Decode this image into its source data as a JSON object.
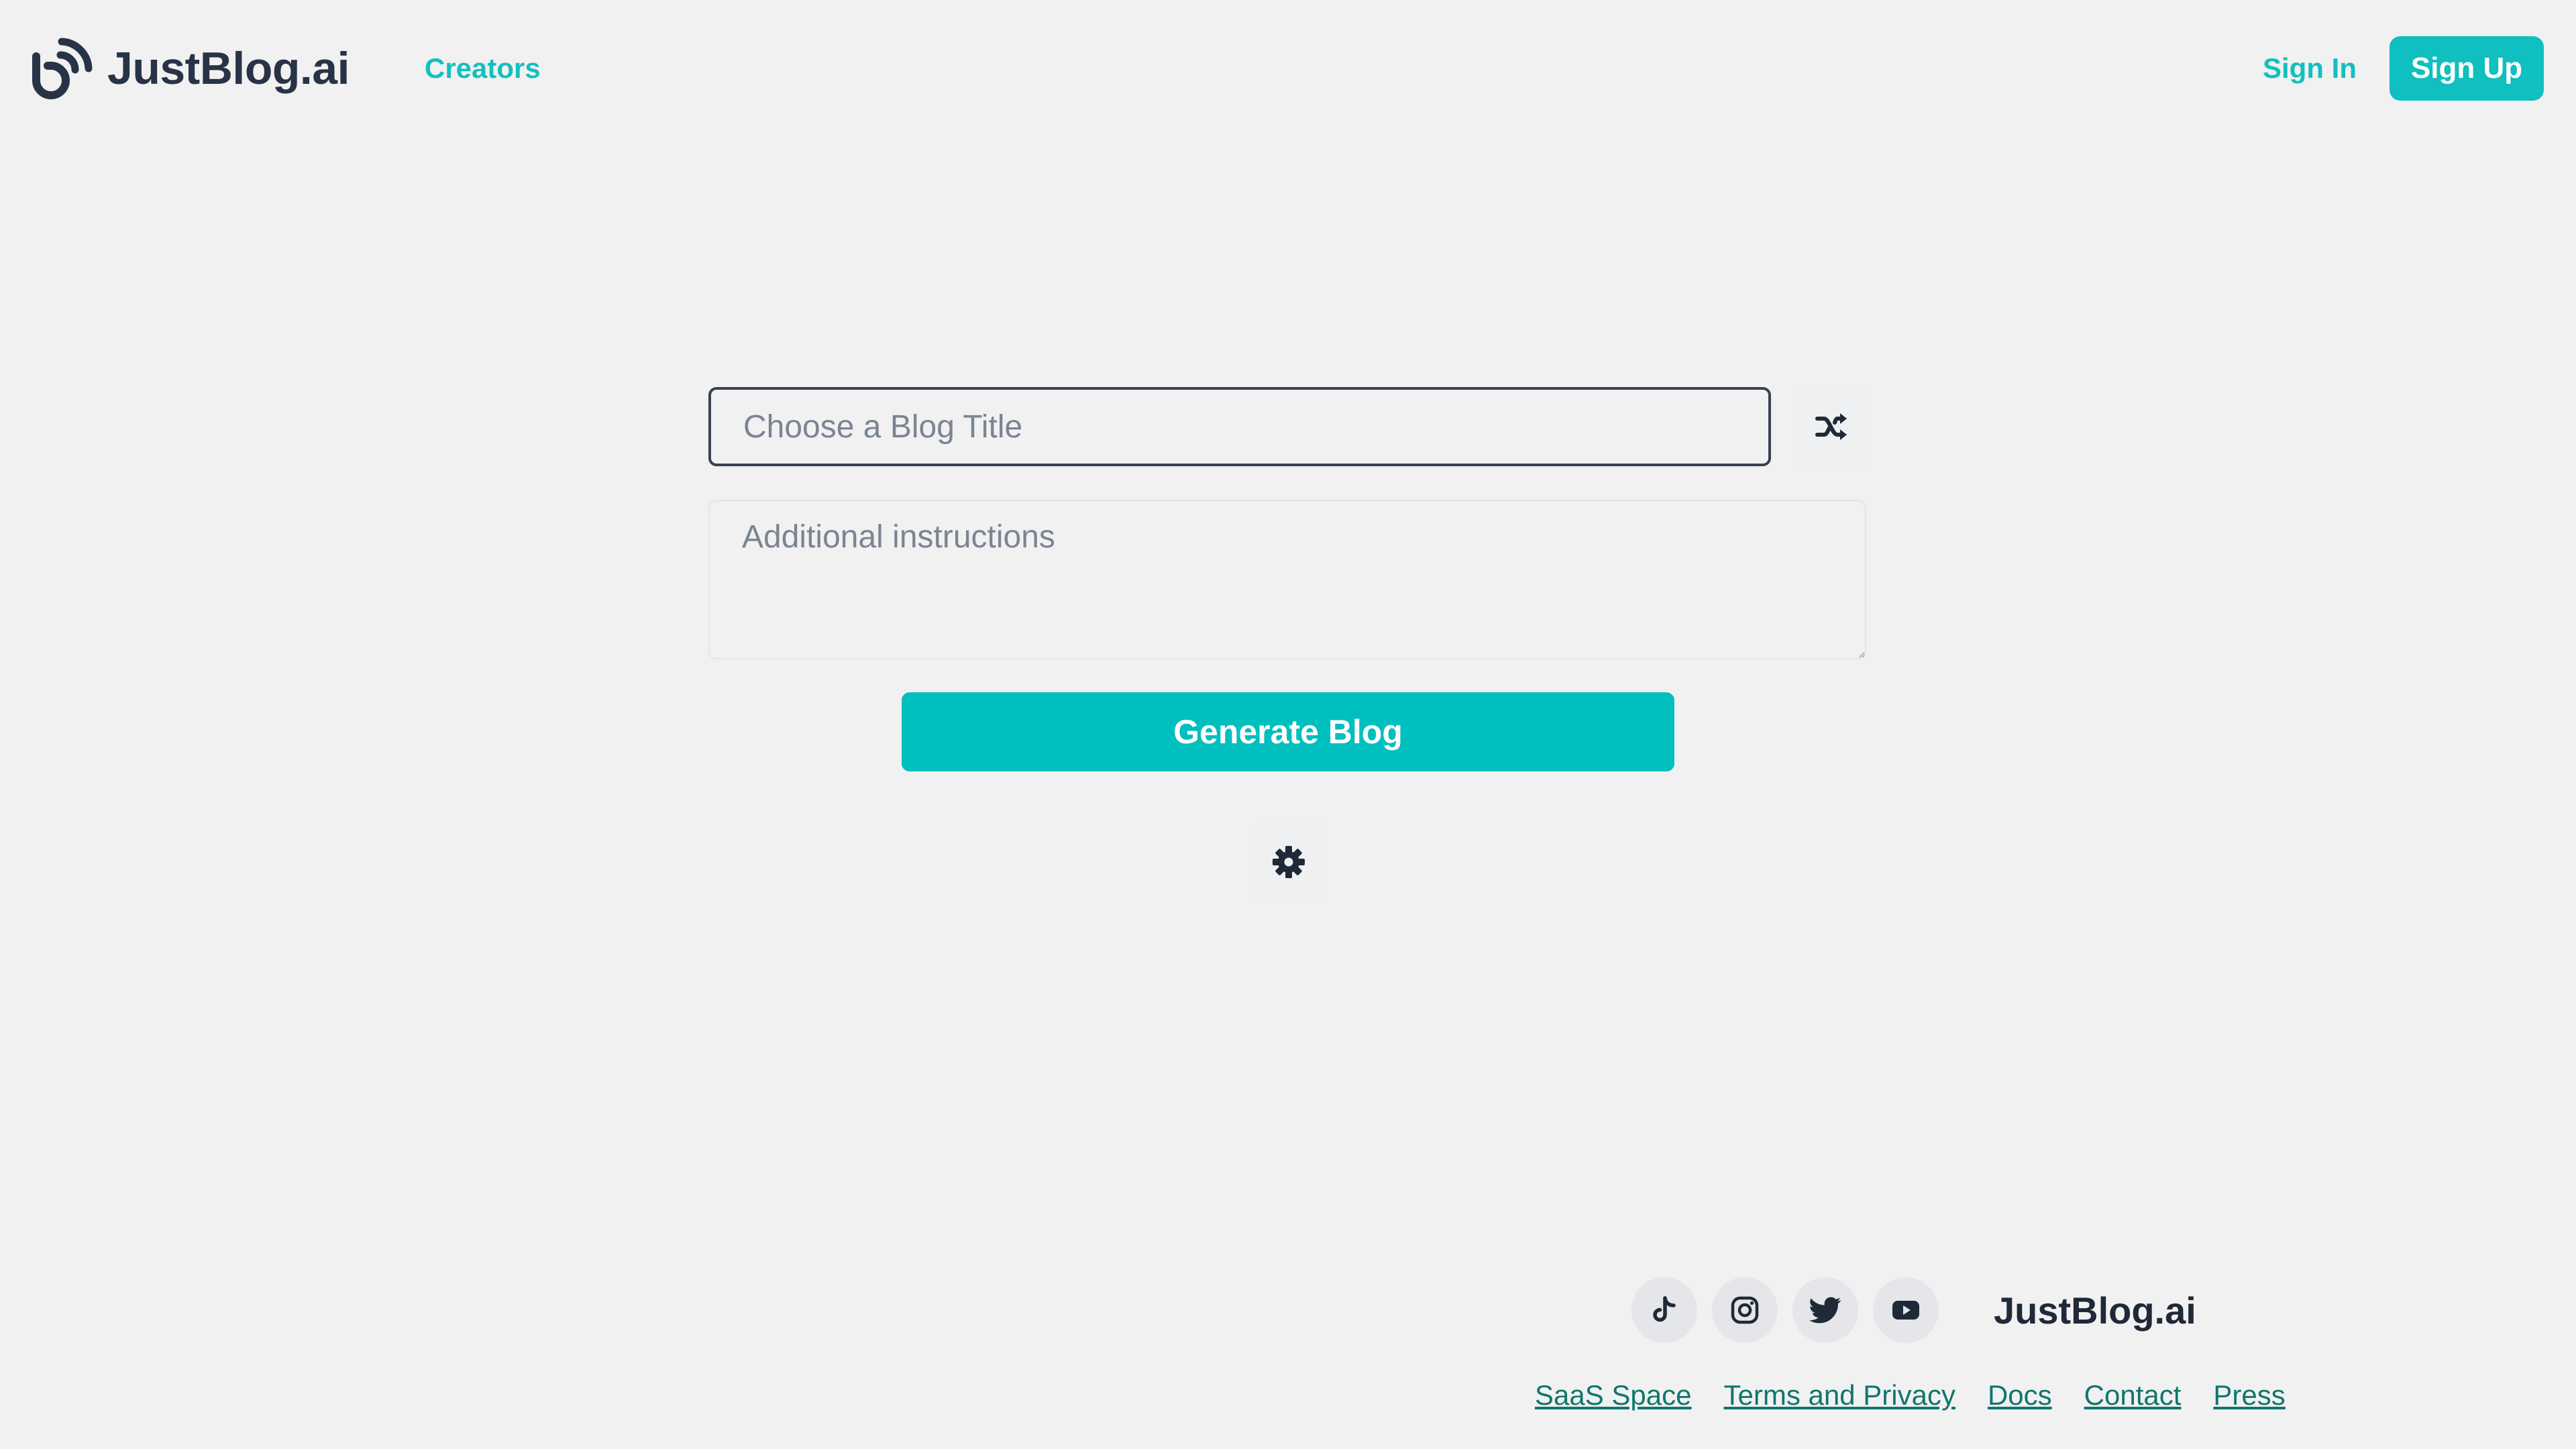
{
  "header": {
    "brand_name": "JustBlog.ai",
    "brand_icon": "broadcast-logo-icon",
    "nav": [
      {
        "label": "Creators"
      }
    ],
    "sign_in_label": "Sign In",
    "sign_up_label": "Sign Up"
  },
  "form": {
    "title": {
      "placeholder": "Choose a Blog Title",
      "value": ""
    },
    "shuffle_icon": "shuffle-icon",
    "instructions": {
      "placeholder": "Additional instructions",
      "value": ""
    },
    "generate_label": "Generate Blog",
    "settings_icon": "gear-icon"
  },
  "footer": {
    "social": [
      {
        "name": "TikTok",
        "icon": "tiktok-icon"
      },
      {
        "name": "Instagram",
        "icon": "instagram-icon"
      },
      {
        "name": "Twitter",
        "icon": "twitter-icon"
      },
      {
        "name": "YouTube",
        "icon": "youtube-icon"
      }
    ],
    "brand_name": "JustBlog.ai",
    "links": [
      {
        "label": "SaaS Space"
      },
      {
        "label": "Terms and Privacy"
      },
      {
        "label": "Docs"
      },
      {
        "label": "Contact"
      },
      {
        "label": "Press"
      }
    ]
  },
  "colors": {
    "background": "#f1f1f1",
    "accent": "#00bfbf",
    "link_accent": "#14bfbf",
    "footer_link": "#0f766e",
    "text_dark": "#283347",
    "placeholder": "#7b8493"
  }
}
